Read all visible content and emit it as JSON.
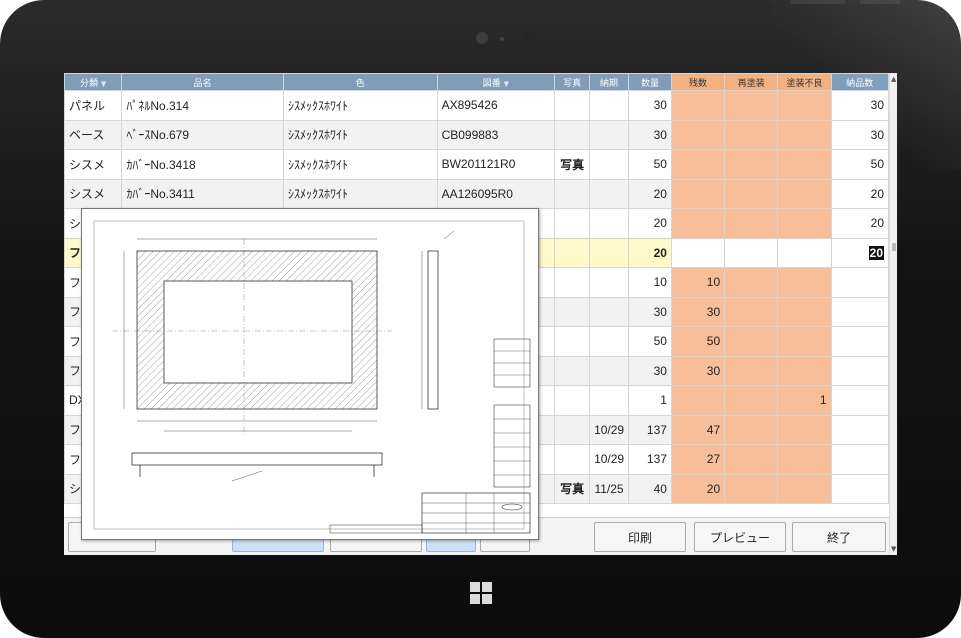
{
  "columns": [
    {
      "label": "分類",
      "sort": "▼"
    },
    {
      "label": "品名"
    },
    {
      "label": "色"
    },
    {
      "label": "図番",
      "sort": "▼"
    },
    {
      "label": "写真"
    },
    {
      "label": "納期"
    },
    {
      "label": "数量"
    },
    {
      "label": "残数"
    },
    {
      "label": "再塗装"
    },
    {
      "label": "塗装不良"
    },
    {
      "label": "納品数"
    }
  ],
  "rows": [
    {
      "bunrui": "パネル",
      "hinmei": "ﾊﾟﾈﾙNo.314",
      "iro": "ｼｽﾒｯｸｽﾎﾜｲﾄ",
      "zuban": "AX895426",
      "shashin": "",
      "nouki": "",
      "suryo": "30",
      "zansu": "",
      "saitoso": "",
      "furyo": "",
      "nohin": "30"
    },
    {
      "bunrui": "ベース",
      "hinmei": "ﾍﾞｰｽNo.679",
      "iro": "ｼｽﾒｯｸｽﾎﾜｲﾄ",
      "zuban": "CB099883",
      "shashin": "",
      "nouki": "",
      "suryo": "30",
      "zansu": "",
      "saitoso": "",
      "furyo": "",
      "nohin": "30"
    },
    {
      "bunrui": "シスメ",
      "hinmei": "ｶﾊﾞｰNo.3418",
      "iro": "ｼｽﾒｯｸｽﾎﾜｲﾄ",
      "zuban": "BW201121R0",
      "shashin": "写真",
      "nouki": "",
      "suryo": "50",
      "zansu": "",
      "saitoso": "",
      "furyo": "",
      "nohin": "50"
    },
    {
      "bunrui": "シスメ",
      "hinmei": "ｶﾊﾞｰNo.3411",
      "iro": "ｼｽﾒｯｸｽﾎﾜｲﾄ",
      "zuban": "AA126095R0",
      "shashin": "",
      "nouki": "",
      "suryo": "20",
      "zansu": "",
      "saitoso": "",
      "furyo": "",
      "nohin": "20"
    },
    {
      "bunrui": "シス",
      "hinmei": "",
      "iro": "",
      "zuban": "",
      "shashin": "",
      "nouki": "",
      "suryo": "20",
      "zansu": "",
      "saitoso": "",
      "furyo": "",
      "nohin": "20"
    },
    {
      "bunrui": "フパ",
      "hinmei": "",
      "iro": "",
      "zuban": "",
      "shashin": "",
      "nouki": "",
      "suryo": "20",
      "zansu": "",
      "saitoso": "",
      "furyo": "",
      "nohin": "20"
    },
    {
      "bunrui": "フパ",
      "hinmei": "",
      "iro": "",
      "zuban": "",
      "shashin": "",
      "nouki": "",
      "suryo": "10",
      "zansu": "10",
      "saitoso": "",
      "furyo": "",
      "nohin": ""
    },
    {
      "bunrui": "フパ",
      "hinmei": "",
      "iro": "",
      "zuban": "",
      "shashin": "",
      "nouki": "",
      "suryo": "30",
      "zansu": "30",
      "saitoso": "",
      "furyo": "",
      "nohin": ""
    },
    {
      "bunrui": "フパ",
      "hinmei": "",
      "iro": "",
      "zuban": "",
      "shashin": "",
      "nouki": "",
      "suryo": "50",
      "zansu": "50",
      "saitoso": "",
      "furyo": "",
      "nohin": ""
    },
    {
      "bunrui": "フパ",
      "hinmei": "",
      "iro": "",
      "zuban": "",
      "shashin": "",
      "nouki": "",
      "suryo": "30",
      "zansu": "30",
      "saitoso": "",
      "furyo": "",
      "nohin": ""
    },
    {
      "bunrui": "DX",
      "hinmei": "",
      "iro": "",
      "zuban": "",
      "shashin": "",
      "nouki": "",
      "suryo": "1",
      "zansu": "",
      "saitoso": "",
      "furyo": "1",
      "nohin": ""
    },
    {
      "bunrui": "フパ",
      "hinmei": "",
      "iro": "",
      "zuban": "",
      "shashin": "",
      "nouki": "10/29",
      "suryo": "137",
      "zansu": "47",
      "saitoso": "",
      "furyo": "",
      "nohin": ""
    },
    {
      "bunrui": "フパ",
      "hinmei": "",
      "iro": "",
      "zuban": "",
      "shashin": "",
      "nouki": "10/29",
      "suryo": "137",
      "zansu": "27",
      "saitoso": "",
      "furyo": "",
      "nohin": ""
    },
    {
      "bunrui": "シス",
      "hinmei": "",
      "iro": "",
      "zuban": "",
      "shashin": "写真",
      "nouki": "11/25",
      "suryo": "40",
      "zansu": "20",
      "saitoso": "",
      "furyo": "",
      "nohin": ""
    }
  ],
  "toolbar": {
    "print_label": "印刷",
    "preview_label": "プレビュー",
    "exit_label": "終了"
  },
  "colors": {
    "header": "#7f9db9",
    "highlight": "#f7bf99",
    "selected_row": "#fff8c8",
    "link": "#1a3ec8"
  },
  "icons": {
    "sort": "triangle-down-icon",
    "start": "windows-logo-icon"
  }
}
